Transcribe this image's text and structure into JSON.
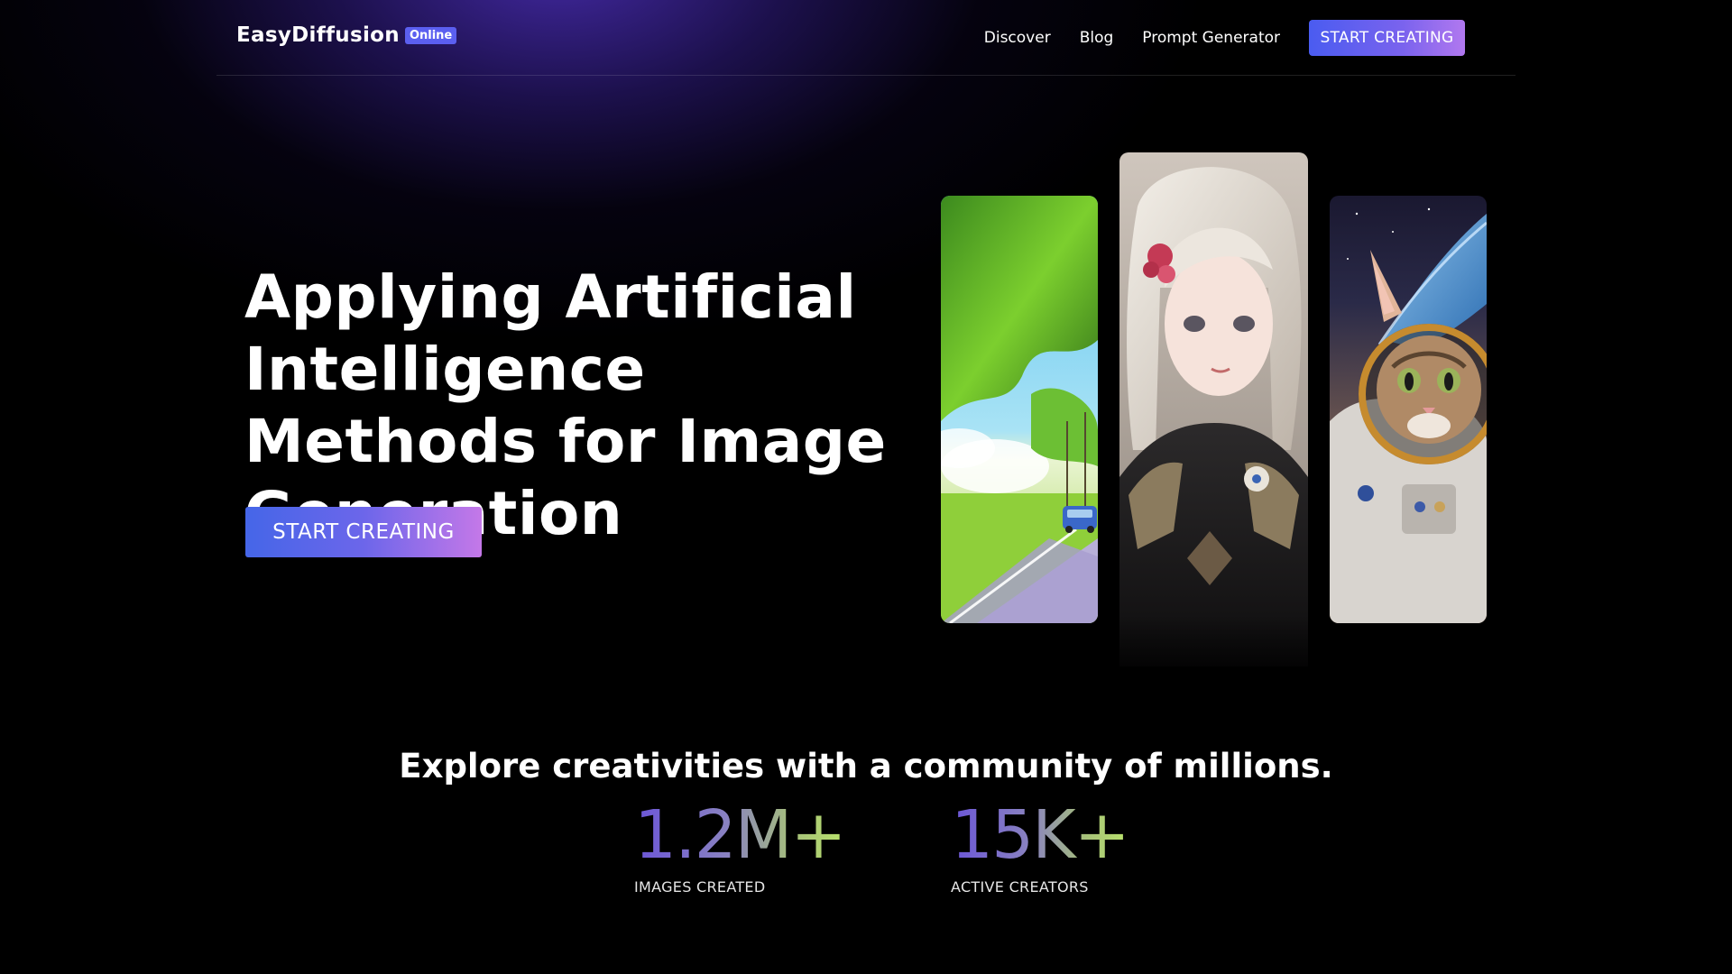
{
  "header": {
    "logo_text": "EasyDiffusion",
    "logo_badge": "Online",
    "nav": [
      {
        "label": "Discover"
      },
      {
        "label": "Blog"
      },
      {
        "label": "Prompt Generator"
      }
    ],
    "cta_label": "START CREATING"
  },
  "hero": {
    "title": "Applying Artificial Intelligence Methods for Image Generation",
    "cta_label": "START CREATING",
    "images": [
      {
        "name": "anime-road-landscape-image"
      },
      {
        "name": "anime-girl-portrait-image"
      },
      {
        "name": "astronaut-cat-image"
      }
    ]
  },
  "community": {
    "title": "Explore creativities with a community of millions.",
    "stats": [
      {
        "value": "1.2M+",
        "label": "IMAGES CREATED"
      },
      {
        "value": "15K+",
        "label": "ACTIVE CREATORS"
      }
    ]
  },
  "colors": {
    "background": "#000000",
    "accent_start": "#4a5cf0",
    "accent_end": "#c478e8",
    "glow": "#4e30be",
    "stat_green": "#b9e36b"
  }
}
